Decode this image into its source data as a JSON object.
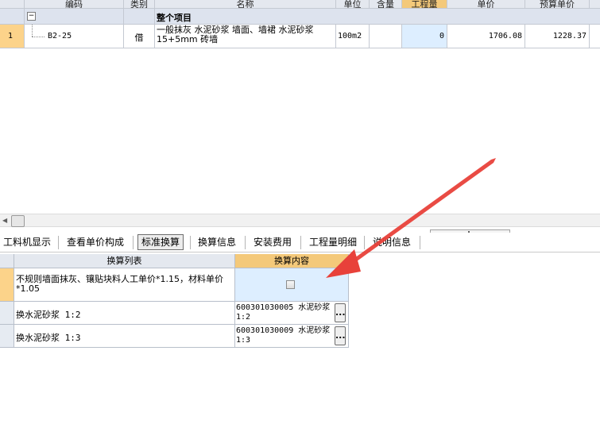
{
  "top_table": {
    "columns": [
      "编码",
      "类别",
      "名称",
      "单位",
      "含量",
      "工程量",
      "单价",
      "预算单价"
    ],
    "group_row": {
      "toggle": "−",
      "label": "整个项目"
    },
    "rows": [
      {
        "index": "1",
        "code": "B2-25",
        "category": "借",
        "name": "一般抹灰 水泥砂浆 墙面、墙裙 水泥砂浆 15+5mm 砖墙",
        "unit": "100m2",
        "content": "",
        "quantity": "0",
        "unit_price": "1706.08",
        "budget_unit_price": "1228.37"
      }
    ]
  },
  "tabs": [
    {
      "label": "工料机显示"
    },
    {
      "label": "查看单价构成"
    },
    {
      "label": "标准换算",
      "active": true
    },
    {
      "label": "换算信息"
    },
    {
      "label": "安装费用"
    },
    {
      "label": "工程量明细"
    },
    {
      "label": "说明信息"
    }
  ],
  "conversion_table": {
    "columns": [
      "换算列表",
      "换算内容"
    ],
    "rows": [
      {
        "item": "不规则墙面抹灰、镶贴块料人工单价*1.15，材料单价*1.05",
        "content": "",
        "content_type": "checkbox",
        "checked": false
      },
      {
        "item": "换水泥砂浆 1:2",
        "content": "600301030005  水泥砂浆 1:2",
        "content_type": "select"
      },
      {
        "item": "换水泥砂浆 1:3",
        "content": "600301030009  水泥砂浆 1:3",
        "content_type": "select"
      }
    ],
    "ellipsis_label": "..."
  },
  "colors": {
    "selected_header": "#f4c97a",
    "row_indicator": "#fcd38a",
    "highlight_cell": "#ddeeff",
    "annotation_arrow": "#e8413a"
  }
}
